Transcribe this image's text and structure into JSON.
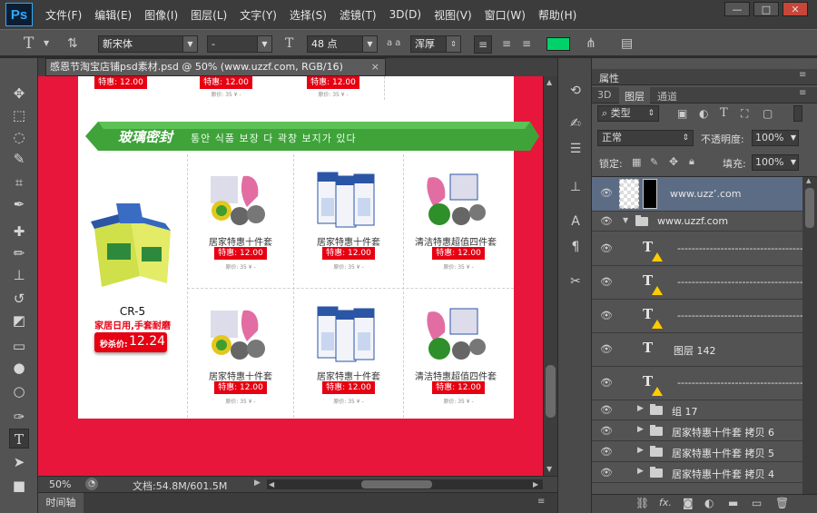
{
  "app": {
    "logo": "Ps"
  },
  "menu": [
    "文件(F)",
    "编辑(E)",
    "图像(I)",
    "图层(L)",
    "文字(Y)",
    "选择(S)",
    "滤镜(T)",
    "3D(D)",
    "视图(V)",
    "窗口(W)",
    "帮助(H)"
  ],
  "window_controls": {
    "minimize": "—",
    "restore": "□",
    "close": "✕"
  },
  "options": {
    "tool_glyph": "T",
    "font_family": "新宋体",
    "font_style": "-",
    "font_size": "48 点",
    "aa_label": "a a",
    "antialias": "浑厚",
    "color": "#00d26a"
  },
  "document_tab": {
    "title": "感恩节淘宝店铺psd素材.psd @ 50% (www.uzzf.com, RGB/16)",
    "close": "×"
  },
  "canvas": {
    "banner": {
      "bold": "玻璃密封",
      "korean": "통안 식품 보장 다 곽창 보지가 있다"
    },
    "top_row_prices": [
      "特惠: 12.00",
      "特惠: 12.00",
      "特惠: 12.00"
    ],
    "top_row_orig": [
      "原价: 35 ¥ -",
      "原价: 35 ¥ -"
    ],
    "featured": {
      "model": "CR-5",
      "slogan": "家居日用,手套耐磨",
      "price_label": "秒杀价:",
      "price": "12.24"
    },
    "products": [
      {
        "name": "居家特惠十件套",
        "price": "特惠: 12.00",
        "orig": "原价: 35 ¥ -"
      },
      {
        "name": "居家特惠十件套",
        "price": "特惠: 12.00",
        "orig": "原价: 35 ¥ -"
      },
      {
        "name": "清洁特惠超值四件套",
        "price": "特惠: 12.00",
        "orig": "原价: 35 ¥ -"
      },
      {
        "name": "居家特惠十件套",
        "price": "特惠: 12.00",
        "orig": "原价: 35 ¥ -"
      },
      {
        "name": "居家特惠十件套",
        "price": "特惠: 12.00",
        "orig": "原价: 35 ¥ -"
      },
      {
        "name": "清洁特惠超值四件套",
        "price": "特惠: 12.00",
        "orig": "原价: 35 ¥ -"
      }
    ]
  },
  "status": {
    "zoom": "50%",
    "doc": "文档:54.8M/601.5M"
  },
  "timeline": {
    "label": "时间轴"
  },
  "panel": {
    "properties_tab": "属性",
    "tabs": [
      "3D",
      "图层",
      "通道"
    ],
    "filter_kind": "类型",
    "blend_mode": "正常",
    "opacity_label": "不透明度:",
    "opacity": "100%",
    "lock_label": "锁定:",
    "fill_label": "填充:",
    "fill": "100%",
    "layers": [
      {
        "name": "www.uzz’.com",
        "type": "image",
        "selected": true
      },
      {
        "name": "www.uzzf.com",
        "type": "group-open"
      },
      {
        "name": "------------------------------------",
        "type": "text"
      },
      {
        "name": "------------------------------------",
        "type": "text"
      },
      {
        "name": "------------------------------------",
        "type": "text"
      },
      {
        "name": "图层 142",
        "type": "text-plain"
      },
      {
        "name": "------------------------------------",
        "type": "text"
      },
      {
        "name": "组 17",
        "type": "group"
      },
      {
        "name": "居家特惠十件套 拷贝 6",
        "type": "group"
      },
      {
        "name": "居家特惠十件套 拷贝 5",
        "type": "group"
      },
      {
        "name": "居家特惠十件套 拷贝 4",
        "type": "group"
      }
    ]
  }
}
